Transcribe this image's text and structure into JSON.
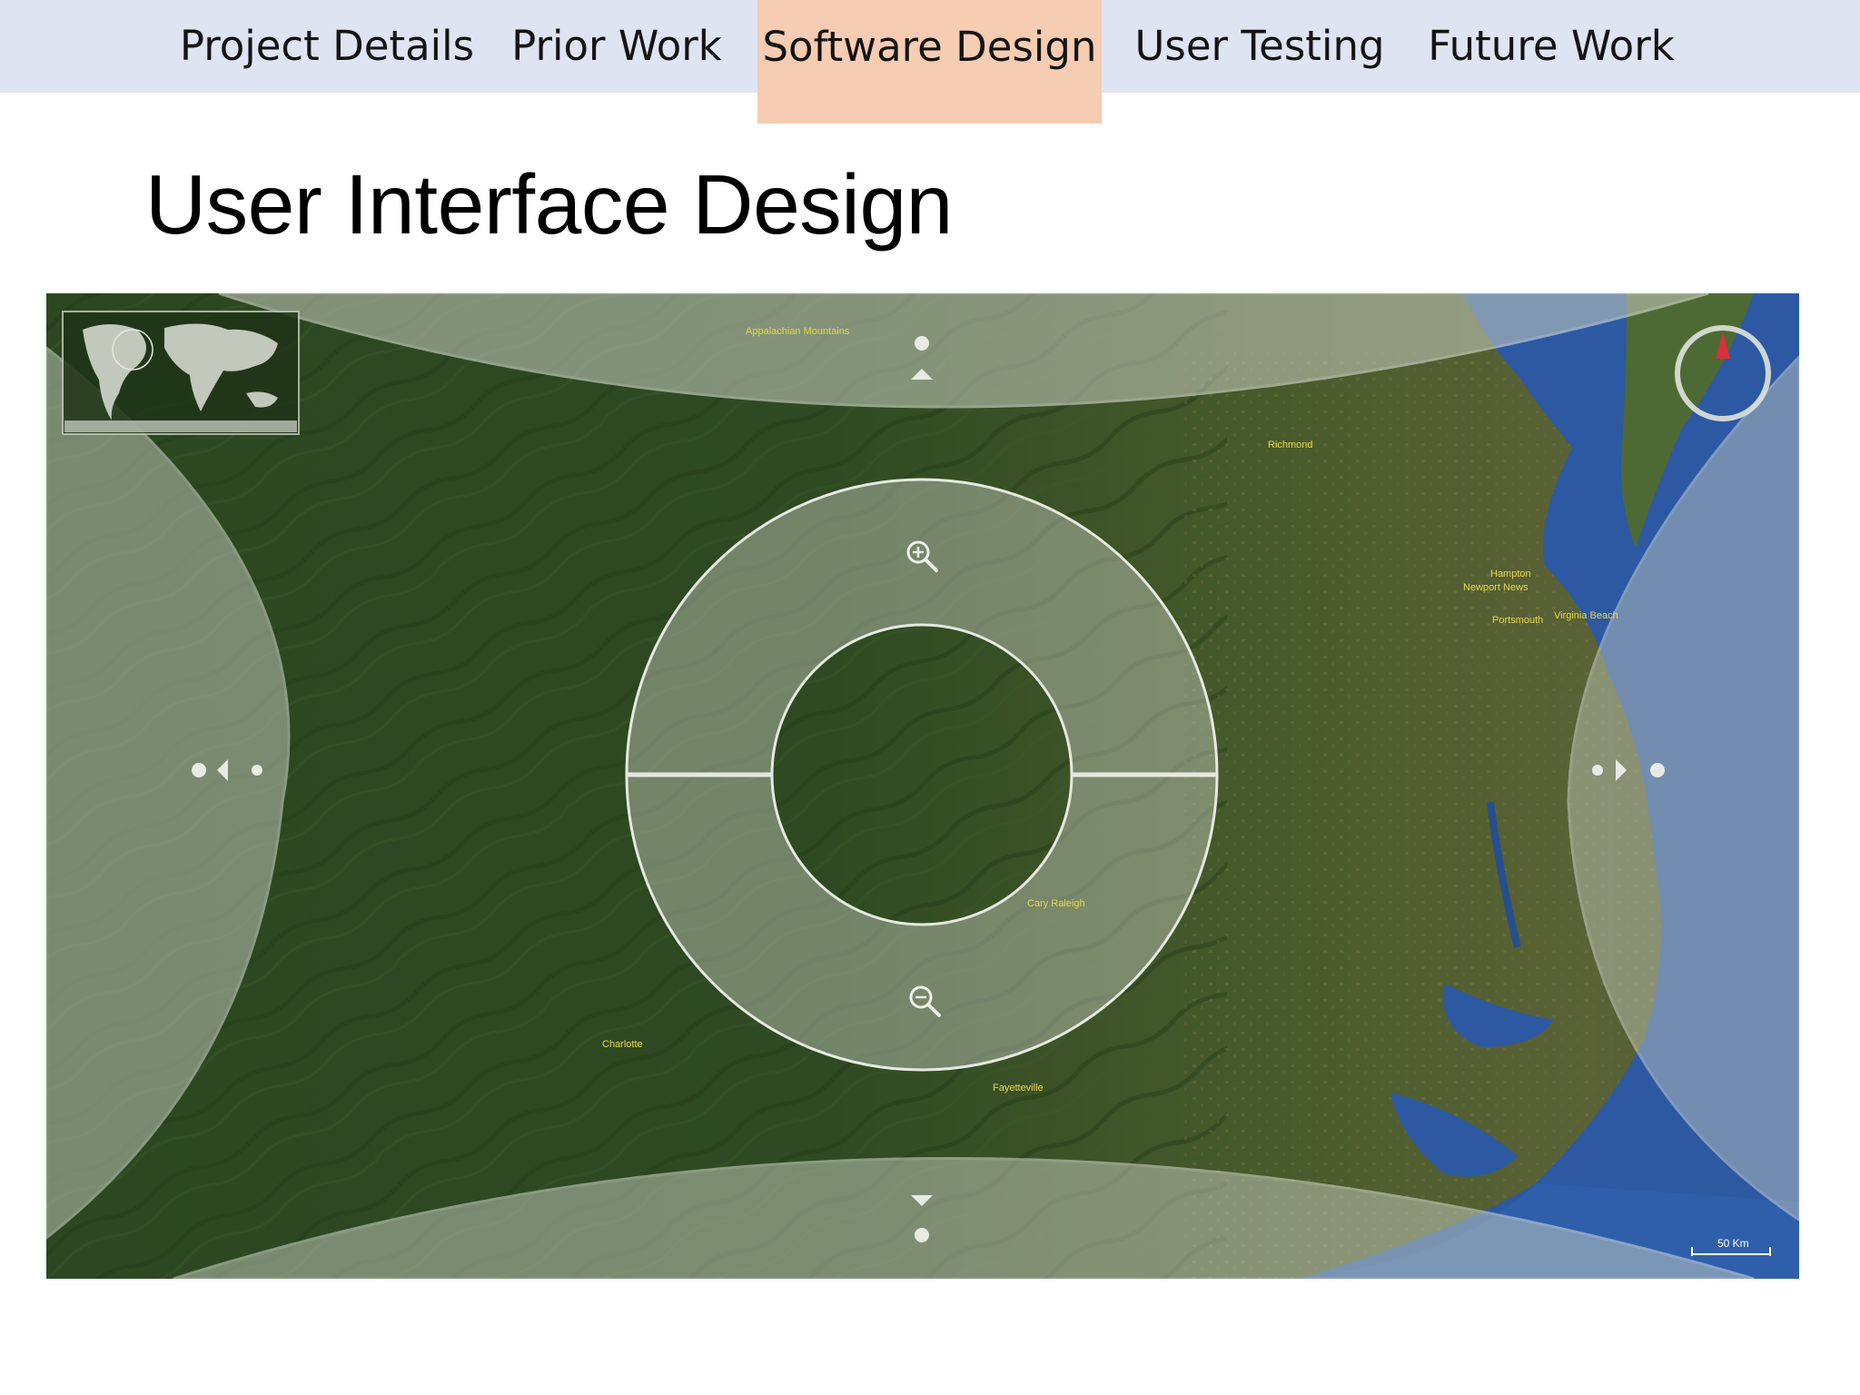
{
  "nav": {
    "tabs": [
      {
        "label": "Project Details",
        "active": false
      },
      {
        "label": "Prior Work",
        "active": false
      },
      {
        "label": "Software Design",
        "active": true
      },
      {
        "label": "User Testing",
        "active": false
      },
      {
        "label": "Future Work",
        "active": false
      }
    ],
    "colors": {
      "bar": "#dfe4f3",
      "active": "#f6ccb2"
    }
  },
  "title": "User Interface Design",
  "map": {
    "labels": {
      "label_top": "Appalachian Mountains",
      "label_richmond": "Richmond",
      "label_hampton": "Hampton",
      "label_newport_news": "Newport News",
      "label_portsmouth": "Portsmouth",
      "label_virginia_beach": "Virginia Beach",
      "label_cary_raleigh": "Cary Raleigh",
      "label_charlotte": "Charlotte",
      "label_fayetteville": "Fayetteville"
    },
    "scale_text": "50 Km",
    "controls": {
      "zoom_in_icon": "zoom-in-icon",
      "zoom_out_icon": "zoom-out-icon",
      "compass_icon": "compass-icon",
      "minimap": "world-minimap"
    },
    "colors": {
      "land_dark": "#2f4a22",
      "land_mid": "#45602d",
      "water": "#2d59a3",
      "overlay": "#c8cdc0"
    }
  }
}
